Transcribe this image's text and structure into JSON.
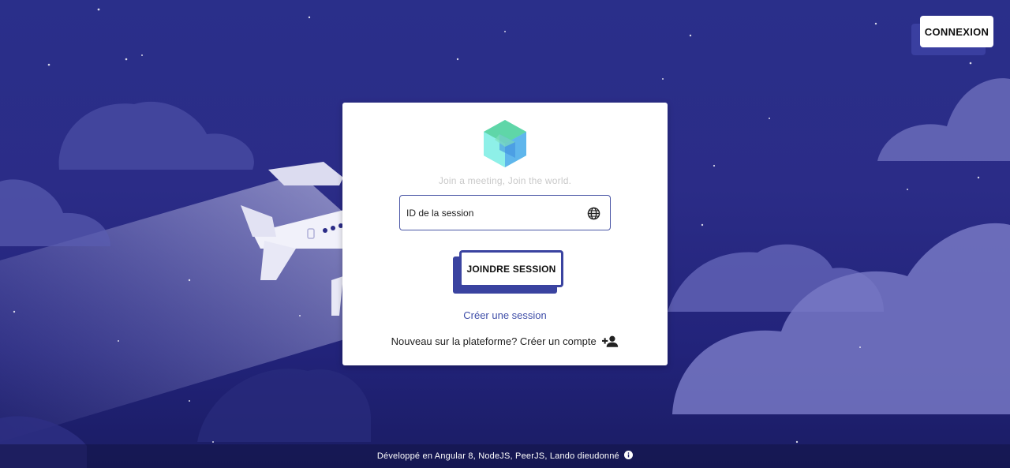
{
  "header": {
    "login_label": "CONNEXION"
  },
  "card": {
    "tagline": "Join a meeting, Join the world.",
    "session_field": {
      "placeholder": "ID de la session",
      "value": ""
    },
    "join_label": "JOINDRE SESSION",
    "create_session_label": "Créer une session",
    "signup_text": "Nouveau sur la plateforme? Créer un compte"
  },
  "footer": {
    "text": "Développé en Angular 8, NodeJS, PeerJS, Lando dieudonné"
  },
  "icons": {
    "logo": "hexagon-cube-logo",
    "field": "globe-icon",
    "signup": "person-add-icon",
    "footer": "info-icon"
  },
  "colors": {
    "background": "#2b2c87",
    "accent": "#3a43a0",
    "link": "#3f4ea8",
    "logo_primary": "#5de0c4",
    "logo_secondary": "#4aa8e8"
  }
}
